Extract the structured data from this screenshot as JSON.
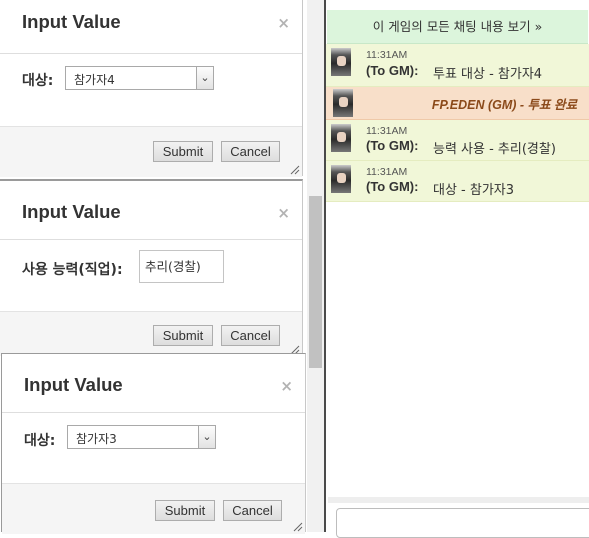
{
  "dialogs": [
    {
      "title": "Input Value",
      "close": "×",
      "field_label": "대상:",
      "select_value": "참가자4",
      "submit": "Submit",
      "cancel": "Cancel"
    },
    {
      "title": "Input Value",
      "close": "×",
      "field_label": "사용 능력(직업):",
      "input_value": "추리(경찰)",
      "submit": "Submit",
      "cancel": "Cancel"
    },
    {
      "title": "Input Value",
      "close": "×",
      "field_label": "대상:",
      "select_value": "참가자3",
      "submit": "Submit",
      "cancel": "Cancel"
    }
  ],
  "chat": {
    "view_all": "이 게임의 모든 채팅 내용 보기 »",
    "messages": [
      {
        "time": "11:31AM",
        "to": "(To GM):",
        "text": "투표 대상 - 참가자4"
      },
      {
        "gm_text": "FP.EDEN (GM) - 투표 완료"
      },
      {
        "time": "11:31AM",
        "to": "(To GM):",
        "text": "능력 사용 - 추리(경찰)"
      },
      {
        "time": "11:31AM",
        "to": "(To GM):",
        "text": "대상 - 참가자3"
      }
    ]
  }
}
